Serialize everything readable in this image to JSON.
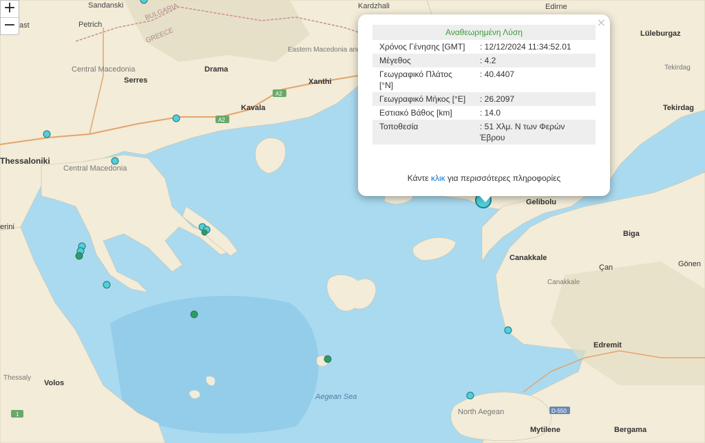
{
  "map": {
    "colors": {
      "land": "#f2ecd8",
      "sea": "#aadaf0",
      "deep_sea": "#94cde9",
      "marker_cyan": "#4fd0da",
      "marker_green": "#2f9e57",
      "border": "#c98f8f",
      "road": "#e5a36a"
    },
    "labels": {
      "sandanski": "Sandanski",
      "petrich": "Petrich",
      "bulgaria": "BULGARIA",
      "greece": "GREECE",
      "kardzhali": "Kardzhali",
      "edirne": "Edirne",
      "luleburgaz": "Lüleburgaz",
      "tekirdag_small": "Tekirdag",
      "tekirdag": "Tekirdag",
      "central_macedonia": "Central Macedonia",
      "serres": "Serres",
      "drama": "Drama",
      "eastern_macedonia": "Eastern Macedonia and Thrace",
      "xanthi": "Xanthi",
      "kavala": "Kavala",
      "thessaloniki": "Thessaloniki",
      "central_macedonia_2": "Central Macedonia",
      "rini": "erini",
      "gelibolu": "Gelibolu",
      "biga": "Biga",
      "canakkale": "Canakkale",
      "canakkale_small": "Canakkale",
      "can": "Çan",
      "gonen": "Gönen",
      "edremit": "Edremit",
      "thessaly": "Thessaly",
      "volos": "Volos",
      "aegean_sea": "Aegean Sea",
      "north_aegean": "North Aegean",
      "mytilene": "Mytilene",
      "bergama": "Bergama",
      "d550": "D-550",
      "a2": "A2",
      "a2_b": "A2",
      "route1": "1",
      "gast": "ast"
    },
    "markers": [
      {
        "name": "marker-drama-area",
        "type": "cyan"
      },
      {
        "name": "marker-thessaloniki-north",
        "type": "cyan"
      },
      {
        "name": "marker-chalkidiki-west",
        "type": "cyan"
      },
      {
        "name": "marker-athos-1",
        "type": "cyan"
      },
      {
        "name": "marker-athos-2",
        "type": "cyan"
      },
      {
        "name": "marker-athos-3",
        "type": "cyan"
      },
      {
        "name": "marker-gulf-1",
        "type": "cyan"
      },
      {
        "name": "marker-gulf-2",
        "type": "cyan"
      },
      {
        "name": "marker-gulf-3",
        "type": "cyan"
      },
      {
        "name": "marker-kassandra",
        "type": "cyan"
      },
      {
        "name": "marker-sea-green-1",
        "type": "green"
      },
      {
        "name": "marker-sea-green-2",
        "type": "green"
      },
      {
        "name": "marker-biga-peninsula",
        "type": "cyan"
      },
      {
        "name": "marker-north-aegean",
        "type": "cyan"
      },
      {
        "name": "marker-top-left",
        "type": "cyan"
      }
    ]
  },
  "zoom": {
    "in": "+",
    "out": "−"
  },
  "popup": {
    "title": "Αναθεωρημένη Λύση",
    "close": "×",
    "rows": [
      {
        "key": "Χρόνος Γένησης [GMT]",
        "value": ": 12/12/2024 11:34:52.01"
      },
      {
        "key": "Μέγεθος",
        "value": ": 4.2"
      },
      {
        "key": "Γεωγραφικό Πλάτος [°N]",
        "value": ": 40.4407"
      },
      {
        "key": "Γεωγραφικό Μήκος [°E]",
        "value": ": 26.2097"
      },
      {
        "key": "Εστιακό Βάθος [km]",
        "value": ": 14.0"
      },
      {
        "key": "Τοποθεσία",
        "value": ": 51 Χλμ. N των Φερών Έβρου"
      }
    ],
    "more_prefix": "Κάντε ",
    "more_link": "κλικ",
    "more_suffix": " για περισσότερες πληροφορίες"
  }
}
